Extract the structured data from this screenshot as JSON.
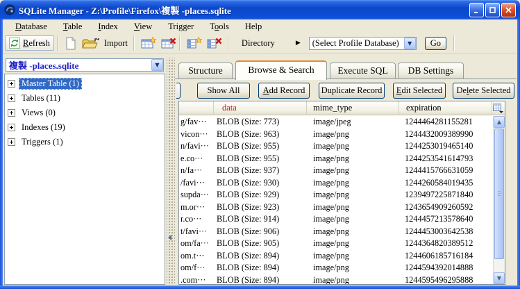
{
  "window": {
    "title": "SQLite Manager - Z:\\Profile\\Firefox\\複製 -places.sqlite"
  },
  "menu": [
    {
      "label": "Database",
      "u": 0
    },
    {
      "label": "Table",
      "u": 0
    },
    {
      "label": "Index",
      "u": 0
    },
    {
      "label": "View",
      "u": 0
    },
    {
      "label": "Trigger",
      "u": -1
    },
    {
      "label": "Tools",
      "u": 1
    },
    {
      "label": "Help",
      "u": -1
    }
  ],
  "toolbar": {
    "refresh_label": "Refresh",
    "import_label": "Import",
    "directory_label": "Directory",
    "profile_select_value": "(Select Profile Database)",
    "go_label": "Go"
  },
  "sidebar": {
    "db_selector_value": "複製 -places.sqlite",
    "tree": [
      {
        "label": "Master Table (1)",
        "selected": true
      },
      {
        "label": "Tables (11)",
        "selected": false
      },
      {
        "label": "Views (0)",
        "selected": false
      },
      {
        "label": "Indexes (19)",
        "selected": false
      },
      {
        "label": "Triggers (1)",
        "selected": false
      }
    ]
  },
  "tabs": [
    {
      "label": "Structure",
      "active": false
    },
    {
      "label": "Browse & Search",
      "active": true
    },
    {
      "label": "Execute SQL",
      "active": false
    },
    {
      "label": "DB Settings",
      "active": false
    }
  ],
  "actions": [
    {
      "label": "Show All",
      "u": -1
    },
    {
      "label": "Add Record",
      "u": 0
    },
    {
      "label": "Duplicate Record",
      "u": -1
    },
    {
      "label": "Edit Selected",
      "u": 0
    },
    {
      "label": "Delete Selected",
      "u": 2
    }
  ],
  "grid": {
    "columns": [
      "",
      "data",
      "mime_type",
      "expiration"
    ],
    "rows": [
      [
        "g/fav···",
        "BLOB (Size: 773)",
        "image/jpeg",
        "1244464281155281"
      ],
      [
        "vicon···",
        "BLOB (Size: 963)",
        "image/png",
        "1244432009389990"
      ],
      [
        "n/favi···",
        "BLOB (Size: 955)",
        "image/png",
        "1244253019465140"
      ],
      [
        "e.co···",
        "BLOB (Size: 955)",
        "image/png",
        "1244253541614793"
      ],
      [
        "n/fa···",
        "BLOB (Size: 937)",
        "image/png",
        "1244415766631059"
      ],
      [
        "/favi···",
        "BLOB (Size: 930)",
        "image/png",
        "1244260584019435"
      ],
      [
        "supda···",
        "BLOB (Size: 929)",
        "image/png",
        "1239497225871840"
      ],
      [
        "m.or···",
        "BLOB (Size: 923)",
        "image/png",
        "1243654909260592"
      ],
      [
        "r.co···",
        "BLOB (Size: 914)",
        "image/png",
        "1244457213578640"
      ],
      [
        "t/favi···",
        "BLOB (Size: 906)",
        "image/png",
        "1244453003642538"
      ],
      [
        "om/fa···",
        "BLOB (Size: 905)",
        "image/png",
        "1244364820389512"
      ],
      [
        "om.t···",
        "BLOB (Size: 894)",
        "image/png",
        "1244606185716184"
      ],
      [
        "om/f···",
        "BLOB (Size: 894)",
        "image/png",
        "1244594392014888"
      ],
      [
        ".com···",
        "BLOB (Size: 894)",
        "image/png",
        "1244595496295888"
      ]
    ]
  },
  "icons": {
    "directory_arrow": "▶",
    "combo_arrow": "▼",
    "scroll_up": "▲",
    "scroll_down": "▼"
  },
  "colors": {
    "titlebar_blue": "#0C47C8",
    "chrome_beige": "#ECE9D8",
    "selection_blue": "#316AC5",
    "active_tab_orange": "#E68B2C",
    "data_header_red": "#B01E1E"
  }
}
